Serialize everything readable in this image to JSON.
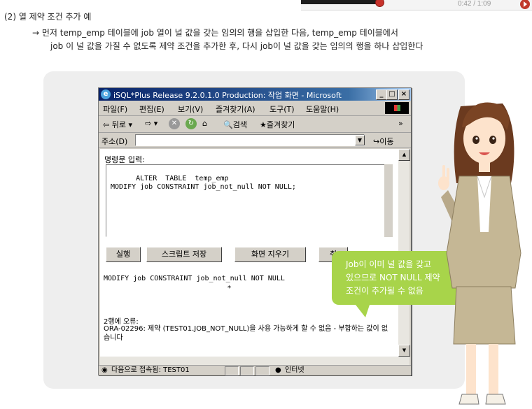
{
  "player": {
    "time": "0:42 / 1:09"
  },
  "heading": "(2) 열 제약 조건 추가 예",
  "bullet": {
    "line1": "→ 먼저 temp_emp 테이블에 job 열이 널 값을 갖는 임의의 행을 삽입한 다음, temp_emp 테이블에서",
    "line2": "job 이 널 값을 가질 수 없도록 제약 조건을 추가한 후, 다시 job이 널 값을 갖는 임의의 행을 하나 삽입한다"
  },
  "window": {
    "title": "iSQL*Plus Release 9.2.0.1.0 Production: 작업 화면 - Microsoft",
    "menu": [
      "파일(F)",
      "편집(E)",
      "보기(V)",
      "즐겨찾기(A)",
      "도구(T)",
      "도움말(H)"
    ],
    "toolbar": {
      "back": "뒤로",
      "search": "검색",
      "favorites": "즐겨찾기",
      "more": "»"
    },
    "address": {
      "label": "주소(D)",
      "value": "",
      "go": "이동"
    },
    "command_label": "명령문 입력:",
    "sql": "ALTER  TABLE  temp_emp\nMODIFY job CONSTRAINT job_not_null NOT NULL;",
    "buttons": [
      "실행",
      "스크립트 저장",
      "화면 지우기",
      "취"
    ],
    "echo": "MODIFY job CONSTRAINT job_not_null NOT NULL",
    "caret": "*",
    "error_header": "2행에 오류:",
    "error_message": "ORA-02296: 제약 (TEST01.JOB_NOT_NULL)을 사용 가능하게 할 수 없음 - 부합하는 값이 없습니다",
    "status": {
      "text": "다음으로 접속됨: TEST01",
      "zone": "인터넷"
    }
  },
  "callout": {
    "line1": "Job이 이미 널 값을 갖고",
    "line2": "있으므로 NOT NULL 제약",
    "line3": "조건이 추가될 수 없음"
  },
  "colors": {
    "callout": "#a8d44a",
    "titlebar": "#0a246a",
    "panel": "#eeeeee"
  }
}
